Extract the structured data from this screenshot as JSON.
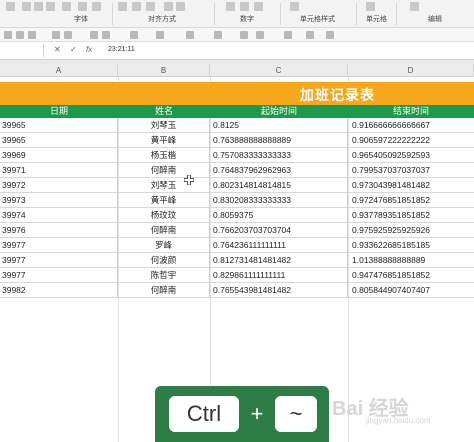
{
  "ribbon": {
    "groups": [
      "字体",
      "对齐方式",
      "数字",
      "单元格样式",
      "单元格",
      "编辑"
    ],
    "top_text": [
      "单元格样式·",
      "单元格",
      "编辑"
    ]
  },
  "formula": {
    "fx": "fx",
    "value": "23:21:11"
  },
  "columns": [
    "A",
    "B",
    "C",
    "D"
  ],
  "sheet": {
    "title": "加班记录表",
    "headers": [
      "日期",
      "姓名",
      "起始时间",
      "结束时间"
    ],
    "rows": [
      [
        "39965",
        "刘琴玉",
        "0.8125",
        "0.916666666666667"
      ],
      [
        "39965",
        "黄平峰",
        "0.763888888888889",
        "0.906597222222222"
      ],
      [
        "39969",
        "杨玉楷",
        "0.757083333333333",
        "0.965405092592593"
      ],
      [
        "39971",
        "何醉南",
        "0.764837962962963",
        "0.799537037037037"
      ],
      [
        "39972",
        "刘琴玉",
        "0.802314814814815",
        "0.973043981481482"
      ],
      [
        "39973",
        "黄平峰",
        "0.830208333333333",
        "0.972476851851852"
      ],
      [
        "39974",
        "杨玟玟",
        "0.8059375",
        "0.937789351851852"
      ],
      [
        "39976",
        "何醉南",
        "0.766203703703704",
        "0.975925925925926"
      ],
      [
        "39977",
        "罗峰",
        "0.764236111111111",
        "0.933622685185185"
      ],
      [
        "39977",
        "何波颜",
        "0.812731481481482",
        "1.01388888888889"
      ],
      [
        "39977",
        "陈哲宇",
        "0.829861111111111",
        "0.947476851851852"
      ],
      [
        "39982",
        "何醉南",
        "0.765543981481482",
        "0.805844907407407"
      ]
    ]
  },
  "overlay": {
    "key1": "Ctrl",
    "plus": "+",
    "key2": "~",
    "watermark": "Bai 经验",
    "watermark_sub": "jingyan.baidu.com"
  }
}
